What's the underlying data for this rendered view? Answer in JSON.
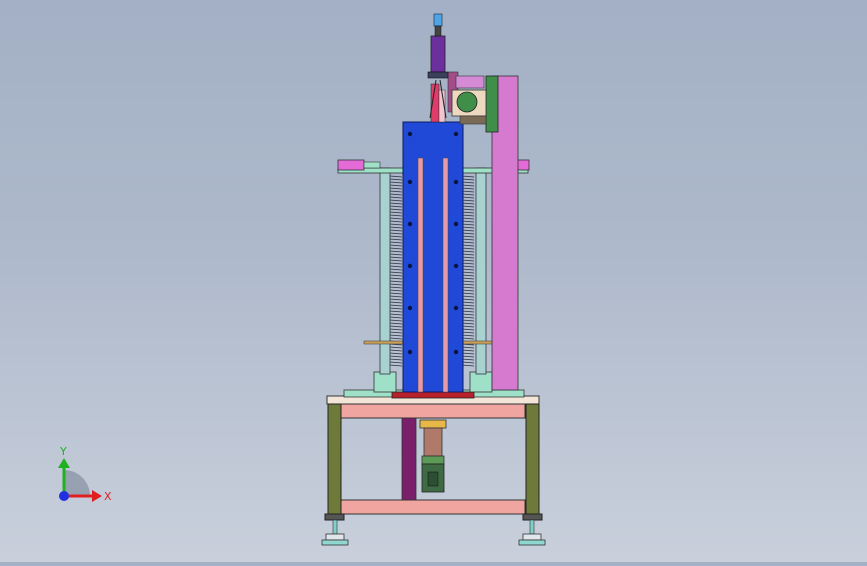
{
  "viewport": {
    "background_top": "#a3b0c5",
    "background_bottom": "#c9d0dc"
  },
  "colors": {
    "frame_olive": "#6e7a3a",
    "frame_pink": "#f0a5a0",
    "column_blue": "#1f49d6",
    "slot_pink": "#e69aa8",
    "side_plate_magenta": "#d67ad0",
    "rod_teal": "#a8d2d0",
    "base_mint": "#9fe0c8",
    "gauge_red": "#b8202a",
    "cylinder_purple": "#6c2f9e",
    "green_block": "#3f8f4a"
  },
  "triad": {
    "x_label": "X",
    "y_label": "Y",
    "x_color": "#e02020",
    "y_color": "#20b020",
    "z_color": "#2030e0"
  }
}
